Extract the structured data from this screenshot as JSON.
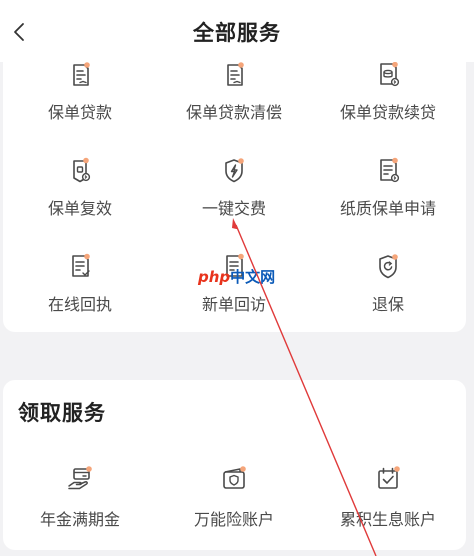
{
  "header": {
    "title": "全部服务",
    "back_icon": "chevron-left-icon"
  },
  "sections": [
    {
      "title": "",
      "items": [
        {
          "label": "保单贷款",
          "icon": "document-lines-icon"
        },
        {
          "label": "保单贷款清偿",
          "icon": "document-lines-icon"
        },
        {
          "label": "保单贷款续贷",
          "icon": "document-coins-refresh-icon"
        },
        {
          "label": "保单复效",
          "icon": "shield-refresh-icon"
        },
        {
          "label": "一键交费",
          "icon": "shield-lightning-icon"
        },
        {
          "label": "纸质保单申请",
          "icon": "document-refresh-icon"
        },
        {
          "label": "在线回执",
          "icon": "document-check-icon"
        },
        {
          "label": "新单回访",
          "icon": "document-phone-icon"
        },
        {
          "label": "退保",
          "icon": "shield-return-icon"
        }
      ]
    },
    {
      "title": "领取服务",
      "items": [
        {
          "label": "年金满期金",
          "icon": "hand-card-icon"
        },
        {
          "label": "万能险账户",
          "icon": "wallet-shield-icon"
        },
        {
          "label": "累积生息账户",
          "icon": "calendar-check-icon"
        }
      ]
    }
  ],
  "watermark": {
    "logo": "php",
    "text": "中文网"
  },
  "colors": {
    "accent_dot": "#f5a57a",
    "icon_stroke": "#4a4a4a",
    "annotation_arrow": "#e03a3a"
  }
}
